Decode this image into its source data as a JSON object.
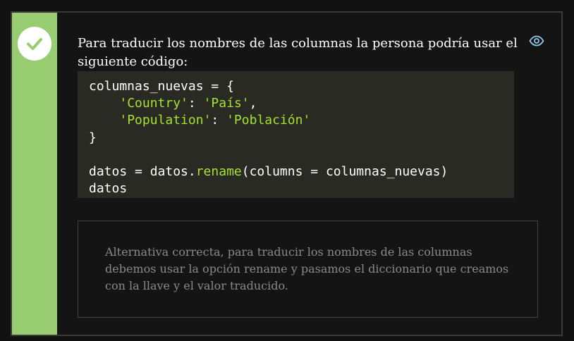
{
  "question": {
    "text": "Para traducir los nombres de las columnas la persona podría usar el siguiente código:"
  },
  "code": {
    "lines": [
      [
        {
          "t": "columnas_nuevas = {",
          "c": "plain"
        }
      ],
      [
        {
          "t": "    ",
          "c": "plain"
        },
        {
          "t": "'Country'",
          "c": "str"
        },
        {
          "t": ": ",
          "c": "plain"
        },
        {
          "t": "'País'",
          "c": "str"
        },
        {
          "t": ",",
          "c": "plain"
        }
      ],
      [
        {
          "t": "    ",
          "c": "plain"
        },
        {
          "t": "'Population'",
          "c": "str"
        },
        {
          "t": ": ",
          "c": "plain"
        },
        {
          "t": "'Población'",
          "c": "str"
        }
      ],
      [
        {
          "t": "}",
          "c": "plain"
        }
      ],
      [
        {
          "t": "",
          "c": "plain"
        }
      ],
      [
        {
          "t": "datos = datos.",
          "c": "plain"
        },
        {
          "t": "rename",
          "c": "fn"
        },
        {
          "t": "(columns = columnas_nuevas)",
          "c": "plain"
        }
      ],
      [
        {
          "t": "datos",
          "c": "plain"
        }
      ]
    ]
  },
  "feedback": {
    "text": "Alternativa correcta, para traducir los nombres de las columnas debemos usar la opción rename y pasamos el diccionario que creamos con la llave y el valor traducido."
  },
  "icons": {
    "status": "check-icon",
    "toggle": "eye-icon"
  },
  "colors": {
    "correct": "#98cc71",
    "code_string": "#a6e22e"
  }
}
